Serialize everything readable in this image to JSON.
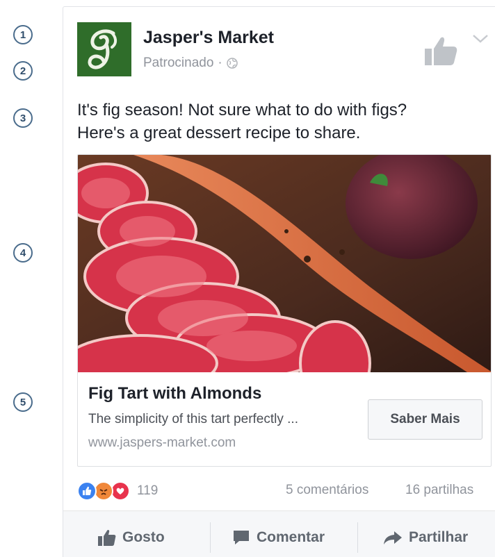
{
  "markers": [
    "1",
    "2",
    "3",
    "4",
    "5"
  ],
  "post": {
    "page_name": "Jasper's Market",
    "sponsored_label": "Patrocinado",
    "separator": "·",
    "text_line1": "It's fig season! Not sure what to do with figs?",
    "text_line2": "Here's a great dessert recipe to share."
  },
  "attachment": {
    "title": "Fig Tart with Almonds",
    "description": "The simplicity of this tart perfectly ...",
    "domain": "www.jaspers-market.com",
    "cta_label": "Saber Mais"
  },
  "summary": {
    "reactions": [
      "like",
      "angry",
      "love"
    ],
    "reaction_count": "119",
    "comments": "5 comentários",
    "shares": "16 partilhas"
  },
  "actions": {
    "like_label": "Gosto",
    "comment_label": "Comentar",
    "share_label": "Partilhar"
  },
  "colors": {
    "brand_green": "#2f6d2a",
    "like_blue": "#3b82f0",
    "angry_orange": "#f0883a",
    "love_red": "#e8334d",
    "muted_text": "#90949c",
    "action_text": "#606770"
  },
  "icons": [
    "jasper-logo",
    "like-page-icon",
    "chevron-down-icon",
    "globe-icon",
    "like-icon",
    "comment-icon",
    "share-icon"
  ]
}
